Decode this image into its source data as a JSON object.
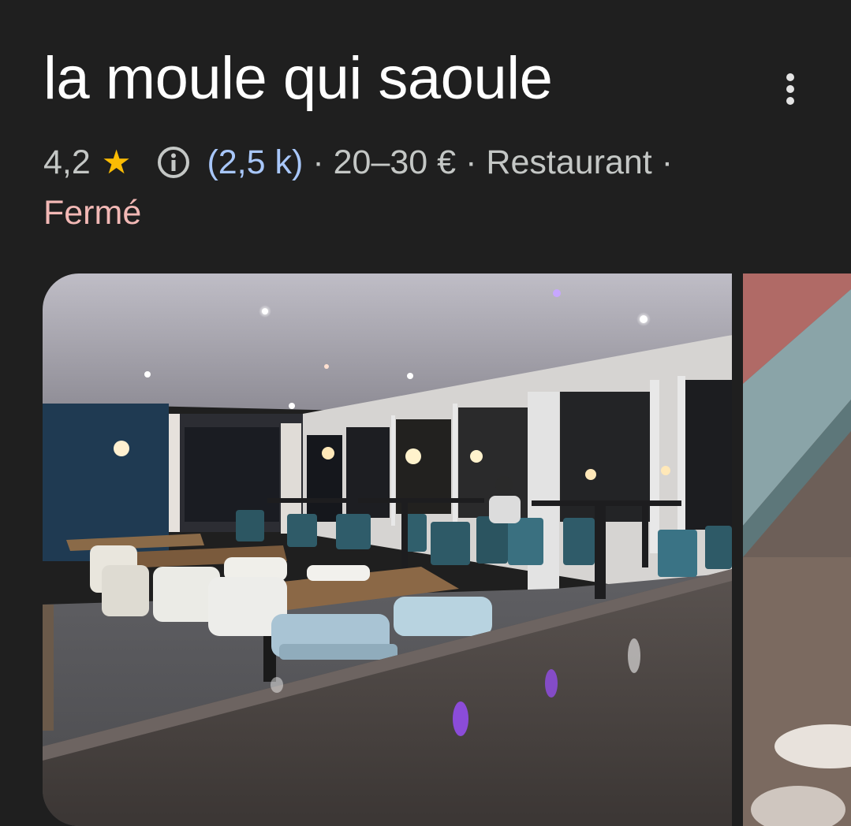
{
  "place": {
    "name": "la moule qui saoule",
    "rating": "4,2",
    "rating_star": "★",
    "reviews": "(2,5 k)",
    "price": "20–30 €",
    "category": "Restaurant",
    "separator": "·",
    "status": "Fermé"
  },
  "icons": {
    "more": "more-vert-icon",
    "info": "info-icon",
    "star": "star-icon"
  },
  "colors": {
    "background": "#1f1f1f",
    "star": "#fbbc04",
    "reviews_link": "#a8c7fa",
    "status_closed": "#f2b8b5"
  }
}
